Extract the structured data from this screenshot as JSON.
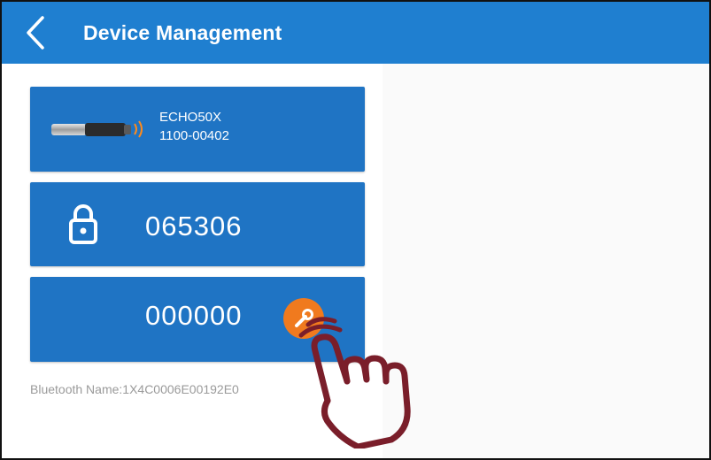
{
  "header": {
    "title": "Device Management",
    "back_icon": "chevron-left-icon",
    "color": "#1f7fd0"
  },
  "device": {
    "name": "ECHO50X",
    "serial": "1100-00402",
    "icon": "wireless-probe-icon"
  },
  "pin": {
    "value": "065306",
    "icon": "lock-icon"
  },
  "code": {
    "value": "000000",
    "edit_icon": "wrench-icon",
    "accent": "#f07a1e"
  },
  "bluetooth": {
    "label": "Bluetooth Name:1X4C0006E00192E0"
  },
  "overlay": {
    "icon": "pointing-hand-icon",
    "color": "#7a1e2a"
  }
}
